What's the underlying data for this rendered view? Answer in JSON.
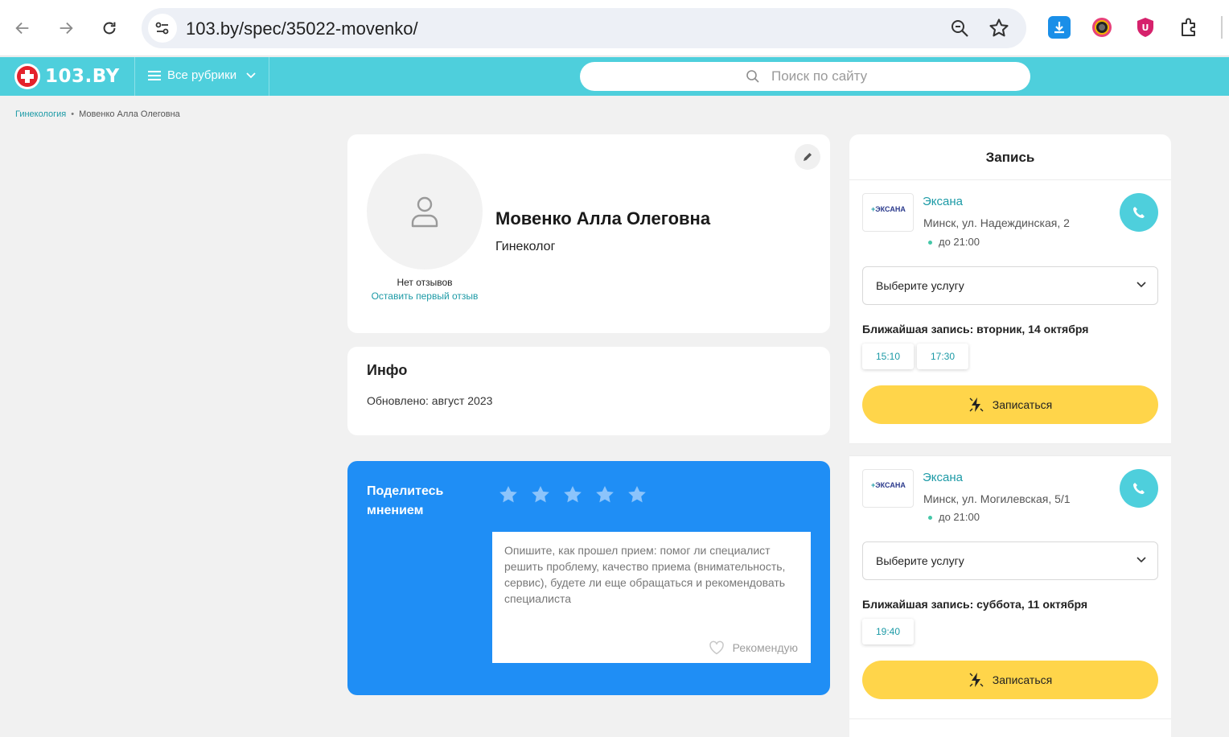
{
  "browser": {
    "url": "103.by/spec/35022-movenko/"
  },
  "site": {
    "logo_text": "103.BY",
    "rubrics_label": "Все рубрики",
    "search_placeholder": "Поиск по сайту"
  },
  "breadcrumb": {
    "category": "Гинекология",
    "separator": "•",
    "current": "Мовенко Алла Олеговна"
  },
  "doctor": {
    "name": "Мовенко Алла Олеговна",
    "specialty": "Гинеколог",
    "reviews_status": "Нет отзывов",
    "leave_review_link": "Оставить первый отзыв"
  },
  "info": {
    "title": "Инфо",
    "updated": "Обновлено: август 2023"
  },
  "review_form": {
    "title": "Поделитесь мнением",
    "stars_count": 5,
    "placeholder": "Опишите, как прошел прием: помог ли специалист решить проблему, качество приема (внимательность, сервис), будете ли еще обращаться и рекомендовать специалиста",
    "recommend_label": "Рекомендую"
  },
  "booking": {
    "title": "Запись",
    "clinics": [
      {
        "logo_text": "ЭКСАНА",
        "name": "Эксана",
        "address": "Минск, ул. Надеждинская, 2",
        "hours": "до 21:00",
        "service_placeholder": "Выберите услугу",
        "nearest": "Ближайшая запись: вторник, 14 октября",
        "slots": [
          "15:10",
          "17:30"
        ],
        "book_label": "Записаться"
      },
      {
        "logo_text": "ЭКСАНА",
        "name": "Эксана",
        "address": "Минск, ул. Могилевская, 5/1",
        "hours": "до 21:00",
        "service_placeholder": "Выберите услугу",
        "nearest": "Ближайшая запись: суббота, 11 октября",
        "slots": [
          "19:40"
        ],
        "book_label": "Записаться"
      }
    ]
  },
  "colors": {
    "header_bg": "#4ecfdc",
    "accent_link": "#1c9aa6",
    "review_card_bg": "#1f8ef5",
    "book_button_bg": "#ffd54a"
  }
}
